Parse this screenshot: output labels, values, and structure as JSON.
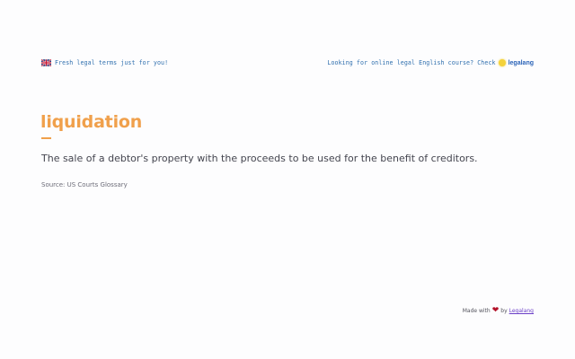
{
  "header": {
    "tagline": "Fresh legal terms just for you!",
    "promo_text": "Looking for online legal English course? Check",
    "brand_link": "legalang"
  },
  "term": {
    "word": "liquidation",
    "definition": "The sale of a debtor's property with the proceeds to be used for the benefit of creditors.",
    "source": "Source: US Courts Glossary"
  },
  "footer": {
    "made_with": "Made with",
    "by": "by",
    "link": "Legalang"
  },
  "colors": {
    "accent": "#f0a04b",
    "link": "#2a63b8",
    "heart": "#b3122a"
  },
  "icons": {
    "flag": "uk-flag-icon",
    "sun": "sun-icon",
    "heart": "heart-icon"
  }
}
